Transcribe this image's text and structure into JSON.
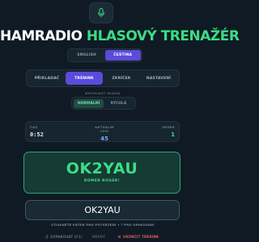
{
  "header": {
    "mic_icon": "microphone-icon",
    "title_white": "HAMRADIO ",
    "title_green": "HLASOVÝ TRENAŽÉR"
  },
  "language": {
    "options": [
      "ENGLISH",
      "ČEŠTINA"
    ],
    "selected": "ČEŠTINA"
  },
  "modes": {
    "tabs": [
      "PŘIKLADAČ",
      "TRÉNINK",
      "ZKRÍČEK",
      "NASTAVENÍ"
    ],
    "selected": "TRÉNINK"
  },
  "speed": {
    "label": "RYCHLOST HLASU",
    "options": [
      "NORMÁLNÍ",
      "RYCHLÁ"
    ],
    "selected": "NORMÁLNÍ"
  },
  "stats": {
    "time_label": "ČAS",
    "time_value": "0:52",
    "wpm_label": "AKTUÁLNÍ CPM",
    "wpm_value": "45",
    "score_label": "SKÓRE",
    "score_value": "1"
  },
  "card": {
    "callsign": "OK2YAU",
    "phonetic": "ROMER ROGER!"
  },
  "answer": {
    "value": "OK2YAU"
  },
  "hint": "STISKNĚTE ENTER PRO POTVRZENÍ • ? PRO OPAKOVÁNÍ",
  "footer": {
    "left": "ZOPAKOVAT (F1)",
    "mid": "NĚKDY",
    "right": "UKONČIT TRÉNINK"
  },
  "colors": {
    "background": "#0f1a24",
    "accent": "#5b4bdb",
    "green": "#3ddc84",
    "danger": "#e25b5b"
  }
}
